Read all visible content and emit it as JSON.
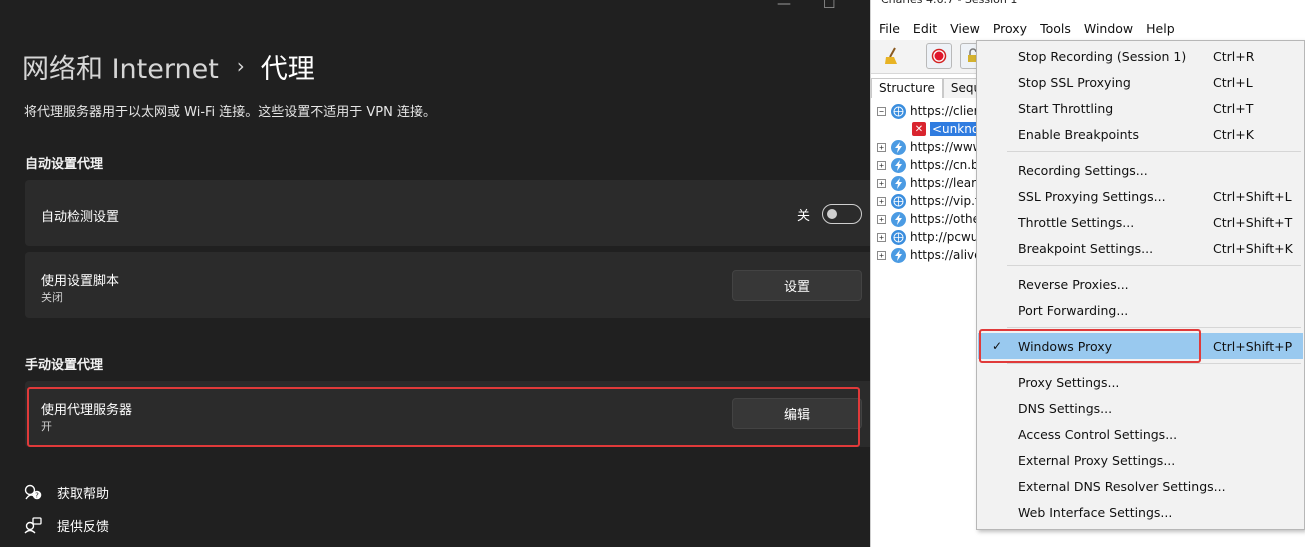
{
  "settings": {
    "breadcrumb_parent": "网络和 Internet",
    "breadcrumb_sep": "›",
    "breadcrumb_current": "代理",
    "description": "将代理服务器用于以太网或 Wi-Fi 连接。这些设置不适用于 VPN 连接。",
    "auto_section": "自动设置代理",
    "auto_detect_label": "自动检测设置",
    "auto_detect_state": "关",
    "script_label": "使用设置脚本",
    "script_sub": "关闭",
    "script_button": "设置",
    "manual_section": "手动设置代理",
    "proxy_label": "使用代理服务器",
    "proxy_sub": "开",
    "proxy_button": "编辑",
    "help_link": "获取帮助",
    "feedback_link": "提供反馈"
  },
  "charles": {
    "title": "Charles 4.6.7 - Session 1",
    "menus": [
      "File",
      "Edit",
      "View",
      "Proxy",
      "Tools",
      "Window",
      "Help"
    ],
    "tabs": [
      "Structure",
      "Seque"
    ],
    "tree": [
      {
        "text": "https://clier",
        "icon": "globe-icon",
        "exp": "−"
      },
      {
        "text": "<unkno",
        "icon": "error-icon",
        "exp": ""
      },
      {
        "text": "https://www",
        "icon": "bolt-icon",
        "exp": "+"
      },
      {
        "text": "https://cn.b",
        "icon": "bolt-icon",
        "exp": "+"
      },
      {
        "text": "https://lear",
        "icon": "bolt-icon",
        "exp": "+"
      },
      {
        "text": "https://vip.t",
        "icon": "globe-icon",
        "exp": "+"
      },
      {
        "text": "https://othe",
        "icon": "bolt-icon",
        "exp": "+"
      },
      {
        "text": "http://pcwu",
        "icon": "globe-icon",
        "exp": "+"
      },
      {
        "text": "https://alive",
        "icon": "bolt-icon",
        "exp": "+"
      }
    ],
    "proxy_menu": [
      {
        "label": "Stop Recording (Session 1)",
        "shortcut": "Ctrl+R"
      },
      {
        "label": "Stop SSL Proxying",
        "shortcut": "Ctrl+L"
      },
      {
        "label": "Start Throttling",
        "shortcut": "Ctrl+T"
      },
      {
        "label": "Enable Breakpoints",
        "shortcut": "Ctrl+K"
      },
      {
        "label": "Recording Settings...",
        "shortcut": ""
      },
      {
        "label": "SSL Proxying Settings...",
        "shortcut": "Ctrl+Shift+L"
      },
      {
        "label": "Throttle Settings...",
        "shortcut": "Ctrl+Shift+T"
      },
      {
        "label": "Breakpoint Settings...",
        "shortcut": "Ctrl+Shift+K"
      },
      {
        "label": "Reverse Proxies...",
        "shortcut": ""
      },
      {
        "label": "Port Forwarding...",
        "shortcut": ""
      },
      {
        "label": "Windows Proxy",
        "shortcut": "Ctrl+Shift+P",
        "checked": true
      },
      {
        "label": "Proxy Settings...",
        "shortcut": ""
      },
      {
        "label": "DNS Settings...",
        "shortcut": ""
      },
      {
        "label": "Access Control Settings...",
        "shortcut": ""
      },
      {
        "label": "External Proxy Settings...",
        "shortcut": ""
      },
      {
        "label": "External DNS Resolver Settings...",
        "shortcut": ""
      },
      {
        "label": "Web Interface Settings...",
        "shortcut": ""
      }
    ],
    "check_glyph": "✓"
  },
  "colors": {
    "settings_bg": "#202020",
    "card_bg": "#2b2b2b",
    "highlight_red": "#e03a3a",
    "menu_selected": "#99c9ef"
  }
}
